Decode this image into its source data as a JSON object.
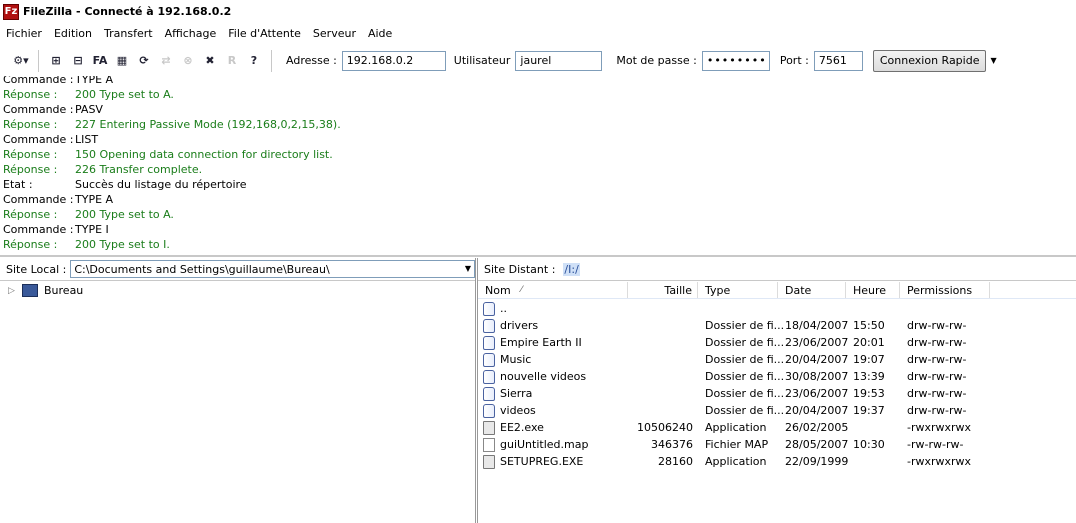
{
  "window": {
    "title": "FileZilla - Connecté à 192.168.0.2",
    "app_icon": "Fz"
  },
  "menu": [
    "Fichier",
    "Edition",
    "Transfert",
    "Affichage",
    "File d'Attente",
    "Serveur",
    "Aide"
  ],
  "toolbar": {
    "icons": [
      {
        "name": "site-manager-icon",
        "glyph": "⚙▾",
        "disabled": false
      },
      {
        "name": "toggle-log-icon",
        "glyph": "⊞",
        "disabled": false
      },
      {
        "name": "toggle-local-tree-icon",
        "glyph": "⊟",
        "disabled": false
      },
      {
        "name": "toggle-remote-tree-icon",
        "glyph": "FA",
        "disabled": false
      },
      {
        "name": "toggle-queue-icon",
        "glyph": "▦",
        "disabled": false
      },
      {
        "name": "refresh-icon",
        "glyph": "⟳",
        "disabled": false
      },
      {
        "name": "process-queue-icon",
        "glyph": "⇄",
        "disabled": true
      },
      {
        "name": "cancel-icon",
        "glyph": "⊗",
        "disabled": true
      },
      {
        "name": "disconnect-icon",
        "glyph": "✖",
        "disabled": false
      },
      {
        "name": "reconnect-icon",
        "glyph": "R",
        "disabled": true
      },
      {
        "name": "help-icon",
        "glyph": "?",
        "disabled": false
      }
    ]
  },
  "quickconnect": {
    "host_label": "Adresse :",
    "host_value": "192.168.0.2",
    "user_label": "Utilisateur",
    "user_value": "jaurel",
    "pass_label": "Mot de passe :",
    "pass_value": "••••••••",
    "port_label": "Port :",
    "port_value": "7561",
    "button_label": "Connexion Rapide"
  },
  "log": [
    {
      "type": "Commande :",
      "msg": "TYPE A",
      "kind": "command"
    },
    {
      "type": "Réponse :",
      "msg": "200 Type set to A.",
      "kind": "response"
    },
    {
      "type": "Commande :",
      "msg": "PASV",
      "kind": "command"
    },
    {
      "type": "Réponse :",
      "msg": "227 Entering Passive Mode (192,168,0,2,15,38).",
      "kind": "response"
    },
    {
      "type": "Commande :",
      "msg": "LIST",
      "kind": "command"
    },
    {
      "type": "Réponse :",
      "msg": "150 Opening data connection for directory list.",
      "kind": "response"
    },
    {
      "type": "Réponse :",
      "msg": "226 Transfer complete.",
      "kind": "response"
    },
    {
      "type": "Etat :",
      "msg": "Succès du listage du répertoire",
      "kind": "status"
    },
    {
      "type": "Commande :",
      "msg": "TYPE A",
      "kind": "command"
    },
    {
      "type": "Réponse :",
      "msg": "200 Type set to A.",
      "kind": "response"
    },
    {
      "type": "Commande :",
      "msg": "TYPE I",
      "kind": "command"
    },
    {
      "type": "Réponse :",
      "msg": "200 Type set to I.",
      "kind": "response"
    }
  ],
  "local": {
    "label": "Site Local :",
    "path": "C:\\Documents and Settings\\guillaume\\Bureau\\",
    "tree": [
      {
        "label": "Bureau"
      }
    ]
  },
  "remote": {
    "label": "Site Distant :",
    "path": "/I:/",
    "columns": [
      "Nom",
      "Taille",
      "Type",
      "Date",
      "Heure",
      "Permissions"
    ],
    "files": [
      {
        "icon": "folder",
        "name": "..",
        "size": "",
        "type": "",
        "date": "",
        "time": "",
        "perms": ""
      },
      {
        "icon": "folder",
        "name": "drivers",
        "size": "",
        "type": "Dossier de fi...",
        "date": "18/04/2007",
        "time": "15:50",
        "perms": "drw-rw-rw-"
      },
      {
        "icon": "folder",
        "name": "Empire Earth II",
        "size": "",
        "type": "Dossier de fi...",
        "date": "23/06/2007",
        "time": "20:01",
        "perms": "drw-rw-rw-"
      },
      {
        "icon": "folder",
        "name": "Music",
        "size": "",
        "type": "Dossier de fi...",
        "date": "20/04/2007",
        "time": "19:07",
        "perms": "drw-rw-rw-"
      },
      {
        "icon": "folder",
        "name": "nouvelle videos",
        "size": "",
        "type": "Dossier de fi...",
        "date": "30/08/2007",
        "time": "13:39",
        "perms": "drw-rw-rw-"
      },
      {
        "icon": "folder",
        "name": "Sierra",
        "size": "",
        "type": "Dossier de fi...",
        "date": "23/06/2007",
        "time": "19:53",
        "perms": "drw-rw-rw-"
      },
      {
        "icon": "folder",
        "name": "videos",
        "size": "",
        "type": "Dossier de fi...",
        "date": "20/04/2007",
        "time": "19:37",
        "perms": "drw-rw-rw-"
      },
      {
        "icon": "app",
        "name": "EE2.exe",
        "size": "10506240",
        "type": "Application",
        "date": "26/02/2005",
        "time": "",
        "perms": "-rwxrwxrwx"
      },
      {
        "icon": "doc",
        "name": "guiUntitled.map",
        "size": "346376",
        "type": "Fichier MAP",
        "date": "28/05/2007",
        "time": "10:30",
        "perms": "-rw-rw-rw-"
      },
      {
        "icon": "app",
        "name": "SETUPREG.EXE",
        "size": "28160",
        "type": "Application",
        "date": "22/09/1999",
        "time": "",
        "perms": "-rwxrwxrwx"
      }
    ]
  },
  "colors": {
    "response_green": "#1a7d1a",
    "folder_blue": "#4a62a0"
  }
}
